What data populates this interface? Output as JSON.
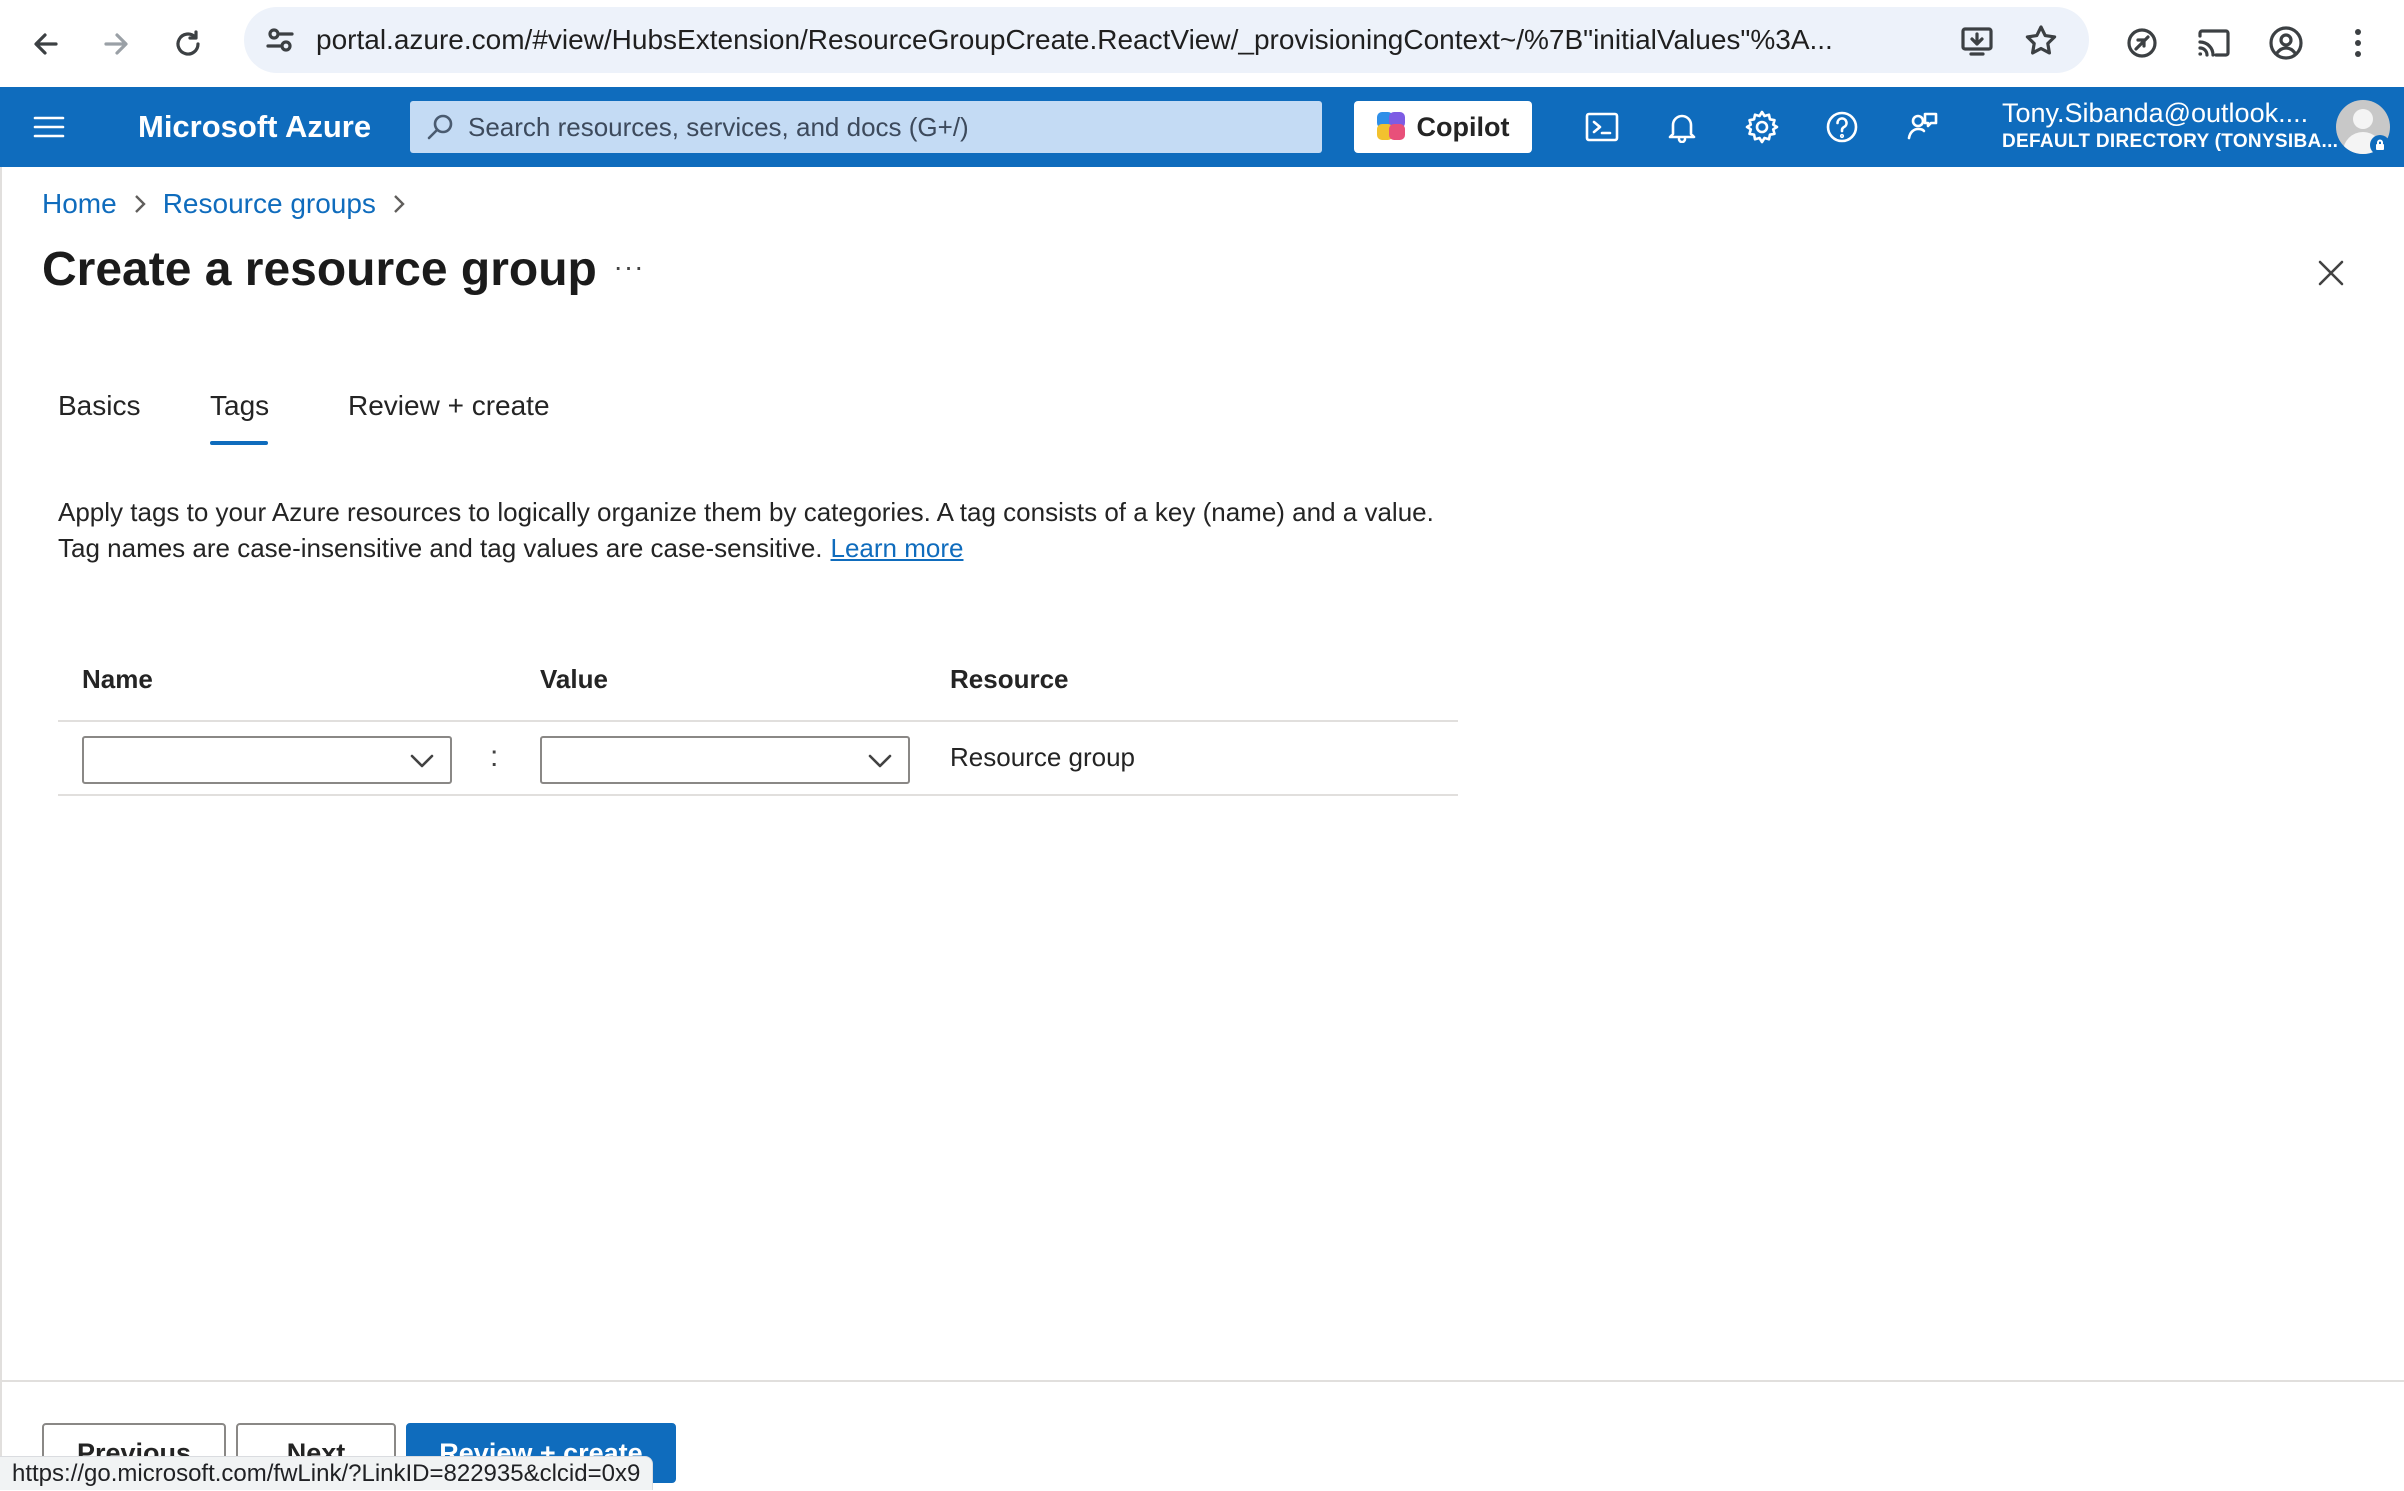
{
  "browser": {
    "url": "portal.azure.com/#view/HubsExtension/ResourceGroupCreate.ReactView/_provisioningContext~/%7B\"initialValues\"%3A...",
    "status_url": "https://go.microsoft.com/fwLink/?LinkID=822935&clcid=0x9"
  },
  "header": {
    "brand": "Microsoft Azure",
    "search_placeholder": "Search resources, services, and docs (G+/)",
    "copilot_label": "Copilot",
    "account_name": "Tony.Sibanda@outlook....",
    "account_directory": "DEFAULT DIRECTORY (TONYSIBA..."
  },
  "breadcrumb": {
    "items": [
      "Home",
      "Resource groups"
    ]
  },
  "page": {
    "title": "Create a resource group",
    "more": "···"
  },
  "tabs": [
    {
      "label": "Basics"
    },
    {
      "label": "Tags",
      "active": true
    },
    {
      "label": "Review + create"
    }
  ],
  "description": {
    "line1": "Apply tags to your Azure resources to logically organize them by categories. A tag consists of a key (name) and a value.",
    "line2": "Tag names are case-insensitive and tag values are case-sensitive.",
    "link": "Learn more"
  },
  "tag_table": {
    "columns": [
      "Name",
      "Value",
      "Resource"
    ],
    "rows": [
      {
        "name": "",
        "value": "",
        "separator": ":",
        "resource": "Resource group"
      }
    ]
  },
  "footer": {
    "previous": "Previous",
    "next": "Next",
    "review_create": "Review + create"
  },
  "colors": {
    "azure_blue": "#0f6cbd",
    "search_bg": "#c4dbf4"
  }
}
